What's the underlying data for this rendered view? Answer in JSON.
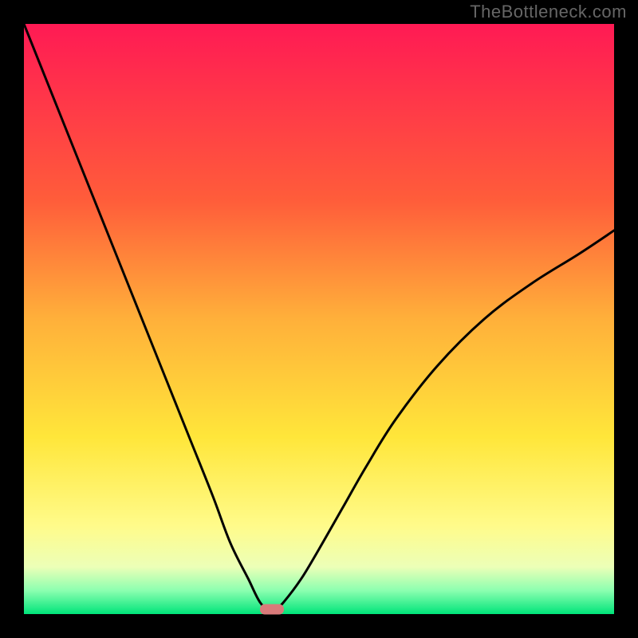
{
  "watermark": "TheBottleneck.com",
  "chart_data": {
    "type": "line",
    "title": "",
    "xlabel": "",
    "ylabel": "",
    "xlim": [
      0,
      100
    ],
    "ylim": [
      0,
      100
    ],
    "grid": false,
    "legend": false,
    "series": [
      {
        "name": "left-branch",
        "x": [
          0,
          4,
          8,
          12,
          16,
          20,
          24,
          28,
          32,
          35,
          38,
          40,
          42
        ],
        "values": [
          100,
          90,
          80,
          70,
          60,
          50,
          40,
          30,
          20,
          12,
          6,
          2,
          0
        ]
      },
      {
        "name": "right-branch",
        "x": [
          42,
          44,
          47,
          50,
          54,
          58,
          63,
          70,
          78,
          86,
          94,
          100
        ],
        "values": [
          0,
          2,
          6,
          11,
          18,
          25,
          33,
          42,
          50,
          56,
          61,
          65
        ]
      }
    ],
    "marker": {
      "x": 42,
      "y": 0,
      "color": "#d97a7a"
    },
    "gradient_colors": {
      "top": "#ff1a54",
      "mid": "#ffe63a",
      "bottom": "#00e47a"
    }
  }
}
